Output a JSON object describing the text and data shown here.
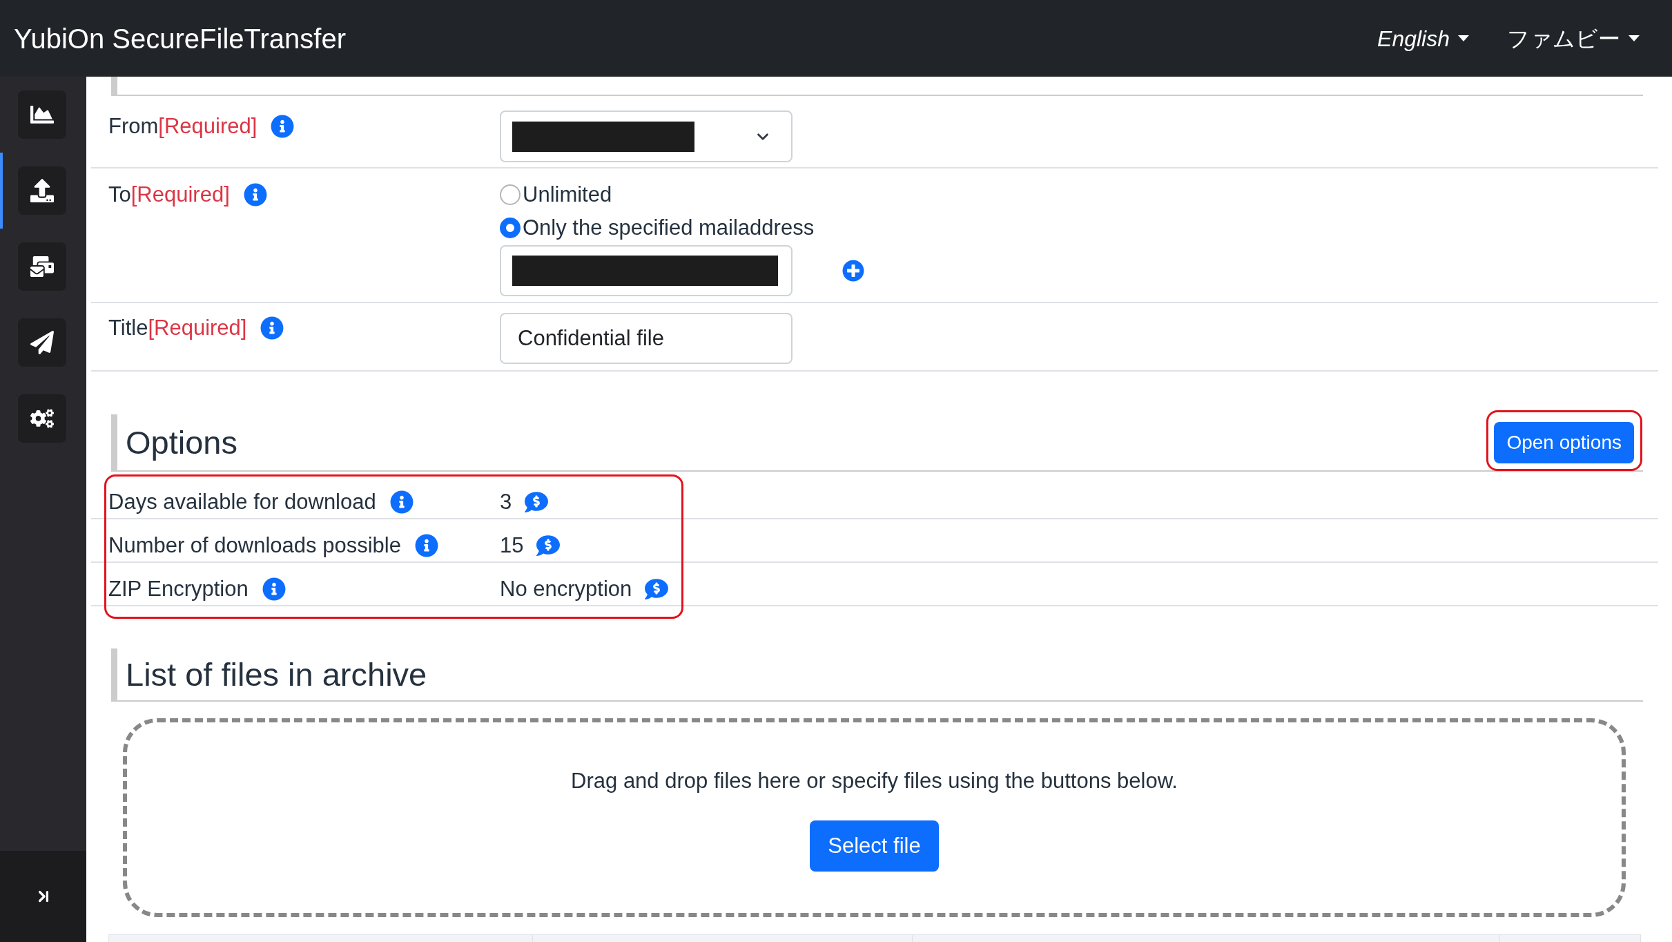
{
  "app_bar": {
    "title": "YubiOn SecureFileTransfer",
    "menus": [
      {
        "label": "English",
        "italic": true
      },
      {
        "label": "ファムビー",
        "italic": false
      }
    ]
  },
  "sidebar": {
    "items": [
      {
        "selected": false
      },
      {
        "selected": true
      },
      {
        "selected": false
      },
      {
        "selected": false
      },
      {
        "selected": false
      }
    ]
  },
  "form": {
    "rows": [
      {
        "kind": "select",
        "label": "From",
        "required_mark": "[Required]",
        "field": {
          "redacted": true
        }
      },
      {
        "kind": "radio",
        "label": "To",
        "required_mark": "[Required]",
        "options": [
          {
            "label": "Unlimited",
            "selected": false
          },
          {
            "label": "Only the specified mailaddress",
            "selected": true
          }
        ],
        "email_field": {
          "redacted": true
        }
      },
      {
        "kind": "text",
        "label": "Title",
        "required_mark": "[Required]",
        "value": "Confidential file"
      }
    ]
  },
  "options": {
    "title": "Options",
    "highlighted": true,
    "button": {
      "label": "Open options",
      "highlighted": true
    },
    "rows": [
      {
        "label": "Days available for download",
        "value": "3"
      },
      {
        "label": "Number of downloads possible",
        "value": "15"
      },
      {
        "label": "ZIP Encryption",
        "value": "No encryption"
      }
    ]
  },
  "files": {
    "title": "List of files in archive",
    "drop_hint": "Drag and drop files here or specify files using the buttons below.",
    "button": "Select file"
  }
}
